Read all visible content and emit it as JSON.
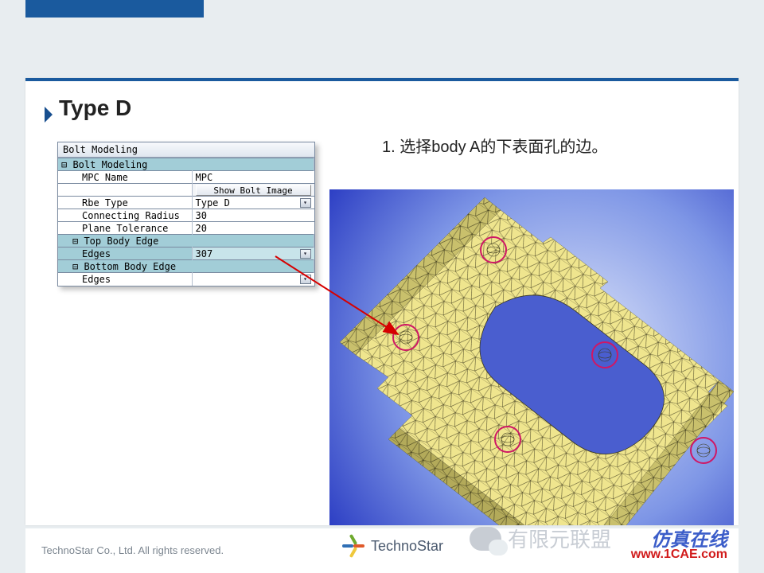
{
  "slide": {
    "title": "Type D",
    "instruction": "1. 选择body A的下表面孔的边。"
  },
  "panel": {
    "title": "Bolt Modeling",
    "group1": "Bolt Modeling",
    "mpc_name_label": "MPC Name",
    "mpc_name_value": "MPC",
    "show_bolt_btn": "Show Bolt Image",
    "rbe_type_label": "Rbe Type",
    "rbe_type_value": "Type D",
    "conn_radius_label": "Connecting Radius",
    "conn_radius_value": "30",
    "plane_tol_label": "Plane Tolerance",
    "plane_tol_value": "20",
    "group2": "Top Body Edge",
    "top_edges_label": "Edges",
    "top_edges_value": "307",
    "group3": "Bottom Body Edge",
    "bot_edges_label": "Edges",
    "bot_edges_value": ""
  },
  "footer": {
    "copyright": "TechnoStar Co., Ltd. All rights reserved.",
    "logo_text": "TechnoStar",
    "wechat_text": "有限元联盟",
    "brand1": "仿真在线",
    "brand2": "www.1CAE.com"
  }
}
